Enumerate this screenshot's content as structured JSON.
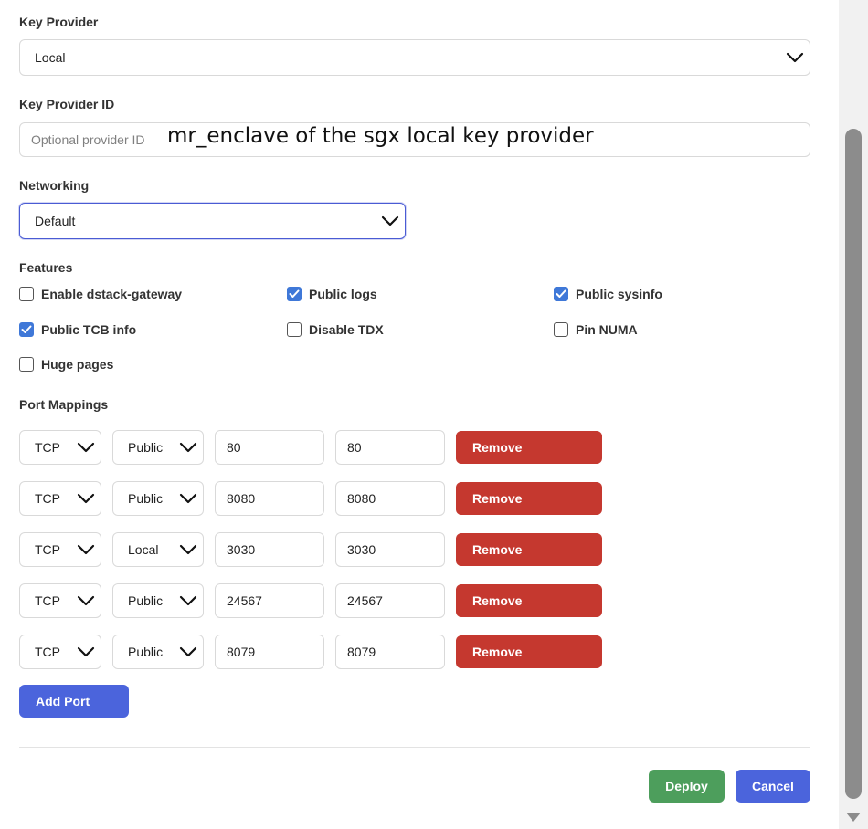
{
  "key_provider": {
    "label": "Key Provider",
    "value": "Local"
  },
  "key_provider_id": {
    "label": "Key Provider ID",
    "placeholder": "Optional provider ID",
    "overlay_text": "mr_enclave of the sgx local key provider"
  },
  "networking": {
    "label": "Networking",
    "value": "Default"
  },
  "features": {
    "label": "Features",
    "items": [
      {
        "label": "Enable dstack-gateway",
        "checked": false
      },
      {
        "label": "Public logs",
        "checked": true
      },
      {
        "label": "Public sysinfo",
        "checked": true
      },
      {
        "label": "Public TCB info",
        "checked": true
      },
      {
        "label": "Disable TDX",
        "checked": false
      },
      {
        "label": "Pin NUMA",
        "checked": false
      },
      {
        "label": "Huge pages",
        "checked": false
      }
    ]
  },
  "port_mappings": {
    "label": "Port Mappings",
    "remove_label": "Remove",
    "add_label": "Add Port",
    "rows": [
      {
        "protocol": "TCP",
        "scope": "Public",
        "host_port": "80",
        "vm_port": "80"
      },
      {
        "protocol": "TCP",
        "scope": "Public",
        "host_port": "8080",
        "vm_port": "8080"
      },
      {
        "protocol": "TCP",
        "scope": "Local",
        "host_port": "3030",
        "vm_port": "3030"
      },
      {
        "protocol": "TCP",
        "scope": "Public",
        "host_port": "24567",
        "vm_port": "24567"
      },
      {
        "protocol": "TCP",
        "scope": "Public",
        "host_port": "8079",
        "vm_port": "8079"
      }
    ]
  },
  "footer": {
    "deploy_label": "Deploy",
    "cancel_label": "Cancel"
  },
  "colors": {
    "remove": "#c5382f",
    "primary": "#4b64dc",
    "deploy": "#4d9e5c",
    "checkbox": "#3f78d8"
  }
}
